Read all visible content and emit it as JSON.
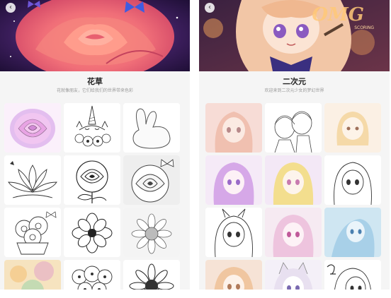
{
  "left_screen": {
    "title": "花草",
    "subtitle": "花就像朋友，它们给我们的世界带来色彩",
    "back_icon": "chevron-left-icon",
    "tiles": [
      {
        "name": "pink-rose-tile",
        "icon": "rose-icon"
      },
      {
        "name": "unicorn-tile",
        "icon": "unicorn-icon"
      },
      {
        "name": "bunny-tile",
        "icon": "bunny-icon"
      },
      {
        "name": "lotus-tile",
        "icon": "lotus-icon"
      },
      {
        "name": "rose-sketch-tile",
        "icon": "rose-icon"
      },
      {
        "name": "rose-butterfly-tile",
        "icon": "rose-icon"
      },
      {
        "name": "flower-bouquet-tile",
        "icon": "bouquet-icon"
      },
      {
        "name": "flower-garland-tile",
        "icon": "flower-icon"
      },
      {
        "name": "sunflower-tile",
        "icon": "sunflower-icon"
      },
      {
        "name": "colored-flowers-tile",
        "icon": "flower-icon"
      },
      {
        "name": "flower-wreath-tile",
        "icon": "flower-icon"
      },
      {
        "name": "sunflower-bloom-tile",
        "icon": "sunflower-icon"
      }
    ]
  },
  "right_screen": {
    "title": "二次元",
    "subtitle": "欢迎来到二次元少女的梦幻世界",
    "hero_text": "OMG",
    "hero_subtext": "SCORING",
    "back_icon": "chevron-left-icon",
    "tiles": [
      {
        "name": "anime-girl-tile",
        "icon": "anime-girl-icon"
      },
      {
        "name": "anime-couple-tile",
        "icon": "anime-couple-icon"
      },
      {
        "name": "anime-chibi-tile",
        "icon": "anime-girl-icon"
      },
      {
        "name": "anime-purple-hair-tile",
        "icon": "anime-girl-icon"
      },
      {
        "name": "anime-yellow-girl-tile",
        "icon": "anime-girl-icon"
      },
      {
        "name": "anime-sketch-girl-tile",
        "icon": "anime-girl-icon"
      },
      {
        "name": "anime-devil-girl-tile",
        "icon": "anime-girl-icon"
      },
      {
        "name": "anime-pink-girl-tile",
        "icon": "anime-girl-icon"
      },
      {
        "name": "anime-mermaid-tile",
        "icon": "anime-girl-icon"
      },
      {
        "name": "anime-peach-girl-tile",
        "icon": "anime-girl-icon"
      },
      {
        "name": "anime-cat-girl-tile",
        "icon": "anime-girl-icon"
      },
      {
        "name": "anime-zodiac-girl-tile",
        "icon": "anime-girl-icon"
      }
    ]
  },
  "colors": {
    "rose": "#f08a88",
    "galaxy": "#3a1d5a",
    "anime_hair": "#f2c6a6",
    "anime_bg": "#5a2b4a",
    "screen_bg": "#f5f5f5"
  }
}
